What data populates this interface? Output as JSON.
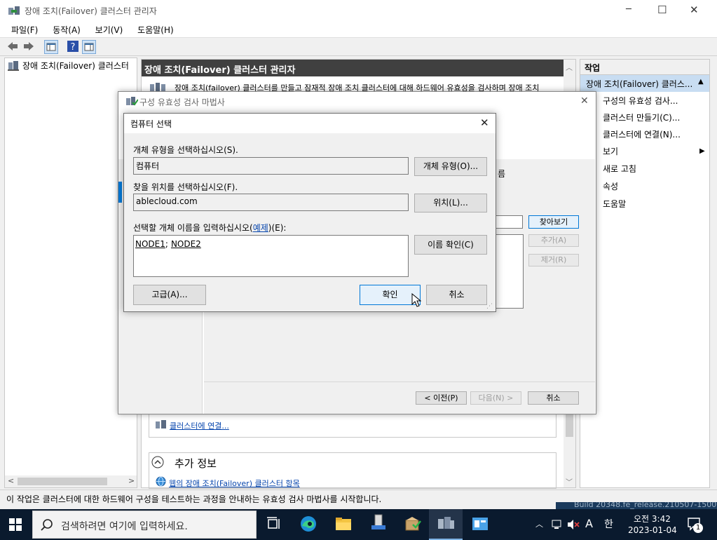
{
  "window": {
    "title": "장애 조치(Failover) 클러스터 관리자",
    "minimize_glyph": "─",
    "maximize_glyph": "☐",
    "close_glyph": "✕"
  },
  "menu": [
    "파일(F)",
    "동작(A)",
    "보기(V)",
    "도움말(H)"
  ],
  "tree": {
    "root_label": "장애 조치(Failover) 클러스터"
  },
  "main": {
    "header_title": "장애 조치(Failover) 클러스터 관리자",
    "intro_text": "장애 조치(failover) 클러스터를 만들고 잠재적 장애 조치 클러스터에 대해 하드웨어 유효성을 검사하며 장애 조치",
    "connect_link": "클러스터에 연결...",
    "more_info_title": "추가 정보",
    "more_info_link": "웹의 장애 조치(Failover) 클러스터 항목"
  },
  "actions": {
    "header": "작업",
    "group_title": "장애 조치(Failover) 클러스...",
    "items": [
      "구성의 유효성 검사...",
      "클러스터 만들기(C)...",
      "클러스터에 연결(N)...",
      "보기",
      "새로 고침",
      "속성",
      "도움말"
    ]
  },
  "wizard": {
    "title": "구성 유효성 검사 마법사",
    "behind_text_fragment": "름",
    "browse_button": "찾아보기",
    "add_button": "추가(A)",
    "remove_button": "제거(R)",
    "prev_button": "< 이전(P)",
    "next_button": "다음(N) >",
    "cancel_button": "취소"
  },
  "dialog": {
    "title": "컴퓨터 선택",
    "object_type_label": "개체 유형을 선택하십시오(S).",
    "object_type_value": "컴퓨터",
    "object_type_button": "개체 유형(O)...",
    "location_label": "찾을 위치를 선택하십시오(F).",
    "location_value": "ablecloud.com",
    "location_button": "위치(L)...",
    "names_label_prefix": "선택할 개체 이름을 입력하십시오(",
    "names_label_link": "예제",
    "names_label_suffix": ")(E):",
    "names_value_1": "NODE1",
    "names_separator": ";",
    "names_value_2": "NODE2",
    "check_names_button": "이름 확인(C)",
    "advanced_button": "고급(A)...",
    "ok_button": "확인",
    "cancel_button": "취소"
  },
  "status_bar": {
    "text": "이 작업은 클러스터에 대한 하드웨어 구성을 테스트하는 과정을 안내하는 유효성 검사 마법사를 시작합니다."
  },
  "desktop": {
    "build_text": "Build 20348.fe_release.210507-1500"
  },
  "taskbar": {
    "search_placeholder": "검색하려면 여기에 입력하세요.",
    "ime_letter": "A",
    "ime_mode": "한",
    "time": "오전 3:42",
    "date": "2023-01-04",
    "notification_count": "1"
  },
  "colors": {
    "accent": "#0078d7",
    "header_dark": "#404040",
    "action_selected": "#c8ddf2",
    "taskbar": "#0a1a2e"
  }
}
